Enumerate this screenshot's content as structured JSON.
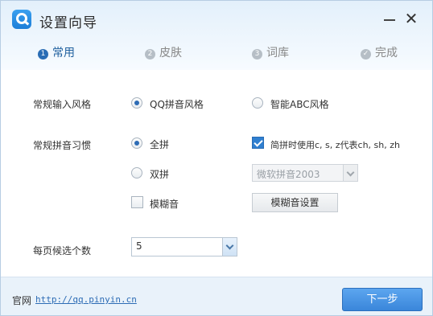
{
  "window": {
    "title": "设置向导",
    "logo_icon": "qq-pinyin-logo-icon",
    "minimize_icon": "minimize-icon",
    "close_label": "✕"
  },
  "steps": [
    {
      "num": "1",
      "label": "常用",
      "active": true
    },
    {
      "num": "2",
      "label": "皮肤",
      "active": false
    },
    {
      "num": "3",
      "label": "词库",
      "active": false
    },
    {
      "num": "✓",
      "label": "完成",
      "active": false
    }
  ],
  "input_style": {
    "label": "常规输入风格",
    "options": [
      {
        "label": "QQ拼音风格",
        "checked": true
      },
      {
        "label": "智能ABC风格",
        "checked": false
      }
    ]
  },
  "pinyin_habit": {
    "label": "常规拼音习惯",
    "full_pinyin": {
      "label": "全拼",
      "checked": true
    },
    "double_pinyin": {
      "label": "双拼",
      "checked": false
    },
    "fuzzy": {
      "label": "模糊音",
      "checked": false
    },
    "abbrev": {
      "label": "简拼时使用c, s, z代表ch, sh, zh",
      "checked": true
    },
    "double_scheme_select": {
      "value": "微软拼音2003",
      "disabled": true
    },
    "fuzzy_settings_button": "模糊音设置"
  },
  "candidates": {
    "label": "每页候选个数",
    "value": "5"
  },
  "footer": {
    "site_label": "官网",
    "site_url": "http://qq.pinyin.cn",
    "next_button": "下一步"
  },
  "colors": {
    "accent": "#2d6cb5",
    "header_bg": "#e3f0fb",
    "footer_bg": "#e9f2fa",
    "next_button": "#3a86da"
  }
}
